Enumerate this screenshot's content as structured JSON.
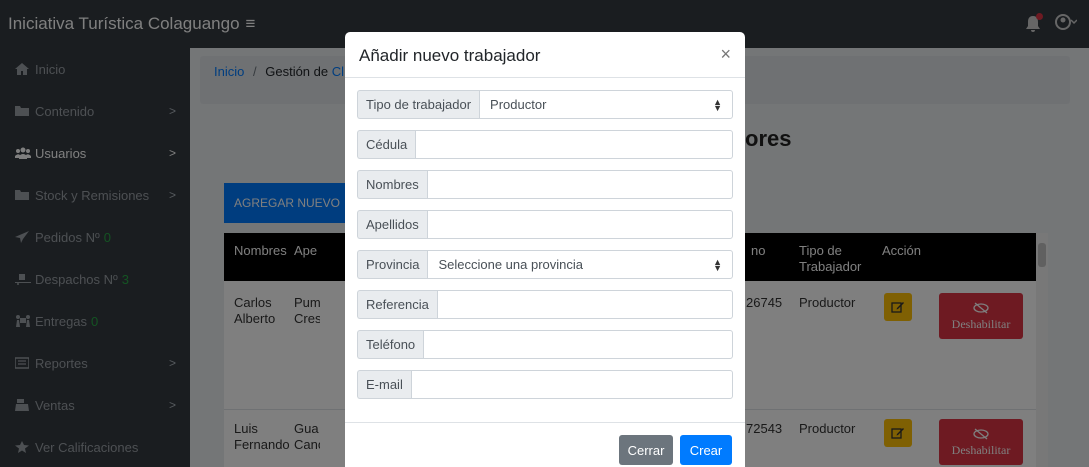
{
  "navbar": {
    "brand": "Iniciativa Turística Colaguango",
    "menu_icon": "≡"
  },
  "sidebar": {
    "items": [
      {
        "label": "Inicio",
        "icon": "home-icon",
        "count": ""
      },
      {
        "label": "Contenido",
        "icon": "folder-icon",
        "count": ""
      },
      {
        "label": "Usuarios",
        "icon": "users-icon",
        "count": ""
      },
      {
        "label": "Stock y Remisiones",
        "icon": "folder-icon",
        "count": ""
      },
      {
        "label": "Pedidos Nº",
        "icon": "paper-plane-icon",
        "count": "0"
      },
      {
        "label": "Despachos Nº",
        "icon": "truck-loading-icon",
        "count": "3"
      },
      {
        "label": "Entregas",
        "icon": "people-carry-icon",
        "count": "0"
      },
      {
        "label": "Reportes",
        "icon": "report-icon",
        "count": ""
      },
      {
        "label": "Ventas",
        "icon": "cash-register-icon",
        "count": ""
      },
      {
        "label": "Ver Calificaciones",
        "icon": "star-icon",
        "count": ""
      }
    ]
  },
  "breadcrumb": {
    "home": "Inicio",
    "separator": "/",
    "current": "Gestión de",
    "link_partial": "Cl"
  },
  "page_title": "ores",
  "add_button": "AGREGAR NUEVO",
  "table": {
    "headers": [
      "Nombres",
      "Ape",
      "no",
      "Tipo de Trabajador",
      "Acción"
    ],
    "rows": [
      {
        "nombres": "Carlos Alberto",
        "apellidos": "Pum Cres",
        "telefono": "26745",
        "tipo": "Productor",
        "disable_label": "Deshabilitar"
      },
      {
        "nombres": "Luis Fernando",
        "apellidos": "Gua Canc",
        "telefono": "72543",
        "tipo": "Productor",
        "disable_label": "Deshabilitar"
      }
    ]
  },
  "modal": {
    "title": "Añadir nuevo trabajador",
    "close_symbol": "×",
    "fields": {
      "tipo": {
        "label": "Tipo de trabajador",
        "value": "Productor"
      },
      "cedula": {
        "label": "Cédula",
        "value": ""
      },
      "nombres": {
        "label": "Nombres",
        "value": ""
      },
      "apellidos": {
        "label": "Apellidos",
        "value": ""
      },
      "provincia": {
        "label": "Provincia",
        "value": "Seleccione una provincia"
      },
      "referencia": {
        "label": "Referencia",
        "value": ""
      },
      "telefono": {
        "label": "Teléfono",
        "value": ""
      },
      "email": {
        "label": "E-mail",
        "value": ""
      }
    },
    "cancel_label": "Cerrar",
    "submit_label": "Crear"
  },
  "colors": {
    "navbar": "#343a40",
    "primary": "#007bff",
    "warning": "#ffc107",
    "danger": "#dc3545",
    "secondary": "#6c757d",
    "success": "#28a745"
  }
}
